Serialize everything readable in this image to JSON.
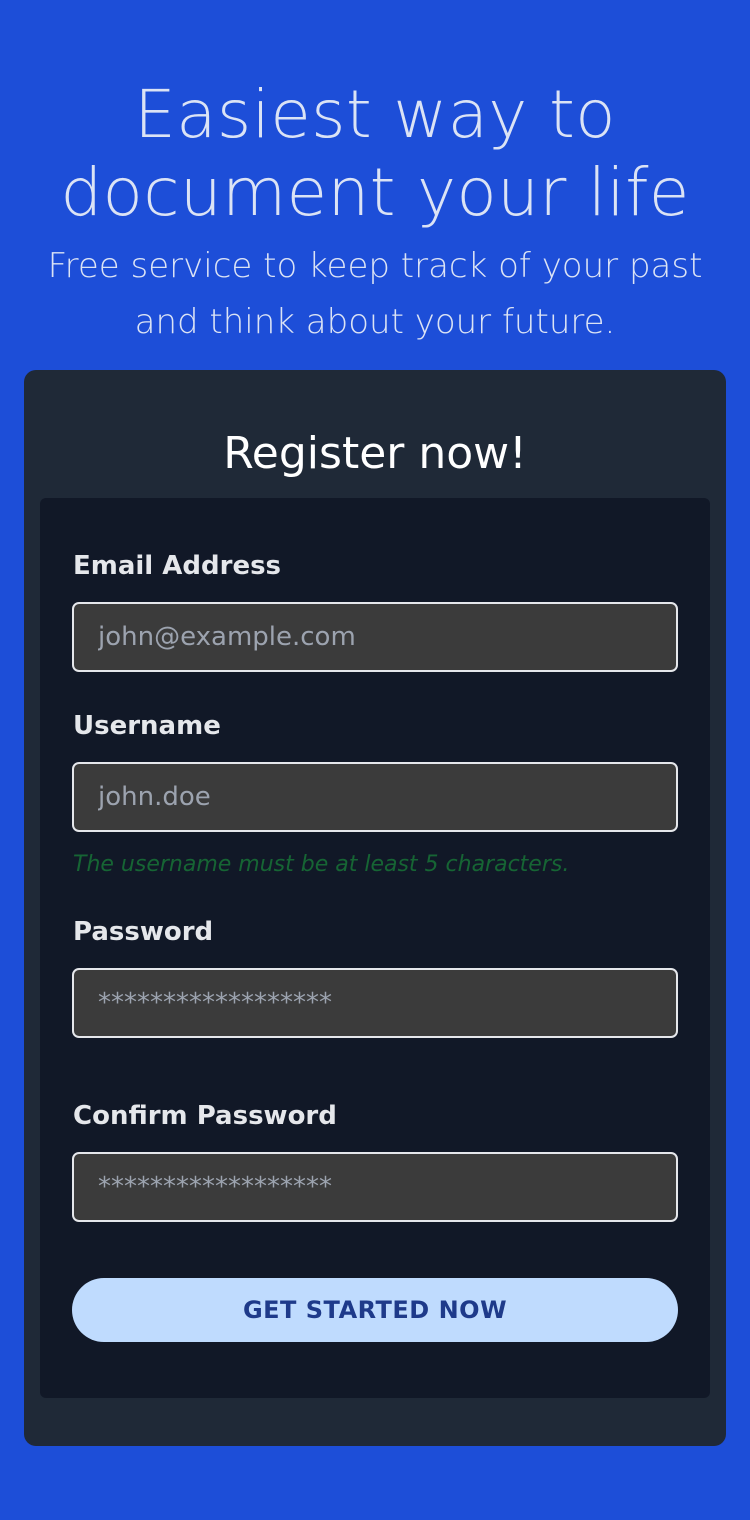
{
  "hero": {
    "title_line1": "Easiest way to",
    "title_line2": "document your life",
    "subtitle_line1": "Free service to keep track of your past",
    "subtitle_line2": "and think about your future."
  },
  "register": {
    "title": "Register now!",
    "email": {
      "label": "Email Address",
      "placeholder": "john@example.com",
      "value": ""
    },
    "username": {
      "label": "Username",
      "placeholder": "john.doe",
      "value": "",
      "hint": "The username must be at least 5 characters."
    },
    "password": {
      "label": "Password",
      "placeholder": "******************",
      "value": ""
    },
    "confirm_password": {
      "label": "Confirm Password",
      "placeholder": "******************",
      "value": ""
    },
    "submit_label": "GET STARTED NOW"
  },
  "colors": {
    "page_background": "#1d4ed8",
    "card_background": "#1f2937",
    "form_background": "#111827",
    "input_background": "#3b3b3b",
    "button_background": "#bfdbfe",
    "button_text": "#1e3a8a",
    "hint_text": "#166534"
  }
}
